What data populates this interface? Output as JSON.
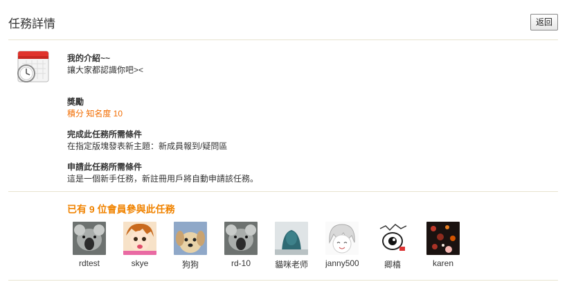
{
  "header": {
    "title": "任務詳情",
    "back_label": "返回"
  },
  "task": {
    "name": "我的介紹~~",
    "description": "讓大家都認識你吧><",
    "reward_label": "獎勵",
    "reward_value": "積分 知名度 10",
    "complete_label": "完成此任務所需條件",
    "complete_text": "在指定版塊發表新主題：新成員報到/疑問區",
    "apply_label": "申請此任務所需條件",
    "apply_text": "這是一個新手任務，新註冊用戶將自動申請該任務。"
  },
  "members": {
    "title": "已有 9 位會員參與此任務",
    "list": [
      {
        "name": "rdtest"
      },
      {
        "name": "skye"
      },
      {
        "name": "狗狗"
      },
      {
        "name": "rd-10"
      },
      {
        "name": "貓咪老师"
      },
      {
        "name": "janny500!"
      },
      {
        "name": "卿橲"
      },
      {
        "name": "karen"
      }
    ]
  },
  "colors": {
    "accent": "#f08300",
    "reward": "#f26c00",
    "divider": "#e8e3cf"
  }
}
